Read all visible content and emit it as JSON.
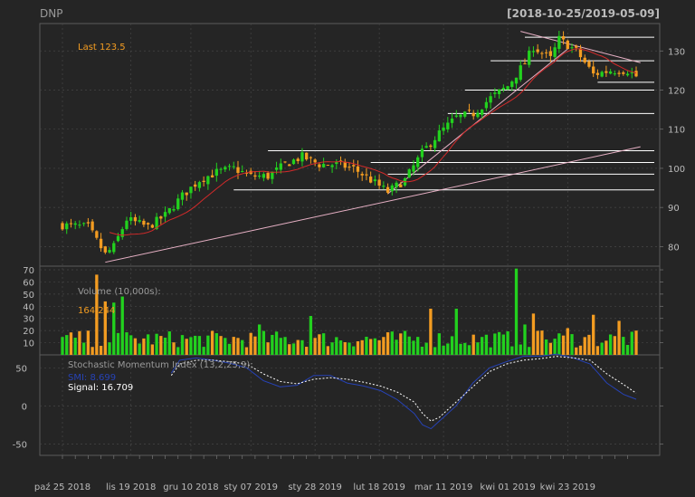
{
  "title": "DNP",
  "date_range": "[2018-10-25/2019-05-09]",
  "last_label": "Last 123.5",
  "volume_label": "Volume (10,000s):",
  "volume_value": "164,244",
  "smi_label": "Stochastic Momentum Index (13,2,25,9):",
  "smi_value": "SMI: 8.699",
  "signal_value": "Signal: 16.709",
  "colors": {
    "background": "#252525",
    "up": "#22d11e",
    "down": "#f39c21",
    "grid": "#464646",
    "sma": "#d42a2a",
    "trendline": "#e6b0c4",
    "smi": "#2642b5",
    "signal": "#ffffff",
    "last": "#f39c21",
    "text": "#bbbbbb"
  },
  "chart_data": [
    {
      "type": "candlestick",
      "title": "DNP",
      "ylim": [
        75,
        137
      ],
      "yticks": [
        80,
        90,
        100,
        110,
        120,
        130
      ],
      "x_tick_labels": [
        "paź 25 2018",
        "lis 19 2018",
        "gru 10 2018",
        "sty 07 2019",
        "sty 28 2019",
        "lut 18 2019",
        "mar 11 2019",
        "kwi 01 2019",
        "kwi 23 2019"
      ],
      "x_tick_index": [
        0,
        16,
        30,
        44,
        59,
        74,
        89,
        104,
        118
      ],
      "n": 135,
      "anchors": [
        [
          0,
          85.5
        ],
        [
          6,
          85
        ],
        [
          10,
          78
        ],
        [
          12,
          80
        ],
        [
          15,
          87
        ],
        [
          20,
          85
        ],
        [
          24,
          88
        ],
        [
          28,
          93
        ],
        [
          32,
          97
        ],
        [
          36,
          99
        ],
        [
          40,
          100
        ],
        [
          44,
          98
        ],
        [
          48,
          98
        ],
        [
          52,
          101
        ],
        [
          56,
          103
        ],
        [
          60,
          101
        ],
        [
          64,
          101
        ],
        [
          68,
          100
        ],
        [
          72,
          97
        ],
        [
          76,
          94
        ],
        [
          80,
          97
        ],
        [
          84,
          104
        ],
        [
          88,
          109
        ],
        [
          92,
          113
        ],
        [
          96,
          114
        ],
        [
          100,
          118
        ],
        [
          104,
          121
        ],
        [
          108,
          127
        ],
        [
          110,
          131
        ],
        [
          114,
          128
        ],
        [
          116,
          133
        ],
        [
          120,
          130
        ],
        [
          124,
          124
        ],
        [
          128,
          125
        ],
        [
          132,
          125
        ],
        [
          134,
          123.5
        ]
      ],
      "last": 123.5,
      "sma_note": "moving average line",
      "horizontal_levels": [
        {
          "y": 133.5,
          "from": 108
        },
        {
          "y": 127.5,
          "from": 100
        },
        {
          "y": 122,
          "from": 125
        },
        {
          "y": 120,
          "from": 94
        },
        {
          "y": 114,
          "from": 90
        },
        {
          "y": 104.5,
          "from": 48
        },
        {
          "y": 101.5,
          "from": 72
        },
        {
          "y": 98.5,
          "from": 76
        },
        {
          "y": 94.5,
          "from": 40
        }
      ],
      "trendlines": [
        [
          [
            10,
            76
          ],
          [
            135,
            105.5
          ]
        ],
        [
          [
            76,
            93.5
          ],
          [
            118,
            130.5
          ]
        ],
        [
          [
            107,
            135
          ],
          [
            135,
            127
          ]
        ]
      ]
    },
    {
      "type": "bar",
      "title": "Volume (10,000s):",
      "ylim": [
        0,
        73
      ],
      "yticks": [
        10,
        20,
        30,
        40,
        50,
        60,
        70
      ],
      "spikes": [
        [
          8,
          66
        ],
        [
          10,
          44
        ],
        [
          12,
          43
        ],
        [
          14,
          48
        ],
        [
          46,
          25
        ],
        [
          58,
          32
        ],
        [
          86,
          38
        ],
        [
          92,
          38
        ],
        [
          106,
          71
        ],
        [
          108,
          25
        ],
        [
          110,
          34
        ],
        [
          112,
          20
        ],
        [
          118,
          22
        ],
        [
          124,
          33
        ],
        [
          130,
          28
        ]
      ],
      "last": 164244
    },
    {
      "type": "line",
      "title": "Stochastic Momentum Index (13,2,25,9):",
      "ylim": [
        -65,
        67
      ],
      "yticks": [
        -50,
        0,
        50
      ],
      "series": [
        {
          "name": "SMI",
          "anchors": [
            [
              26,
              43
            ],
            [
              28,
              60
            ],
            [
              32,
              63
            ],
            [
              36,
              60
            ],
            [
              40,
              56
            ],
            [
              44,
              50
            ],
            [
              48,
              33
            ],
            [
              52,
              25
            ],
            [
              56,
              27
            ],
            [
              60,
              40
            ],
            [
              64,
              40
            ],
            [
              68,
              30
            ],
            [
              72,
              26
            ],
            [
              76,
              20
            ],
            [
              80,
              8
            ],
            [
              84,
              -10
            ],
            [
              86,
              -25
            ],
            [
              88,
              -30
            ],
            [
              90,
              -20
            ],
            [
              94,
              0
            ],
            [
              98,
              30
            ],
            [
              102,
              50
            ],
            [
              106,
              58
            ],
            [
              110,
              65
            ],
            [
              114,
              65
            ],
            [
              118,
              68
            ],
            [
              122,
              63
            ],
            [
              126,
              55
            ],
            [
              130,
              30
            ],
            [
              134,
              15
            ],
            [
              137,
              8.699
            ]
          ]
        },
        {
          "name": "Signal",
          "anchors": [
            [
              26,
              40
            ],
            [
              28,
              55
            ],
            [
              32,
              60
            ],
            [
              36,
              60
            ],
            [
              40,
              58
            ],
            [
              44,
              55
            ],
            [
              48,
              42
            ],
            [
              52,
              32
            ],
            [
              56,
              29
            ],
            [
              60,
              35
            ],
            [
              64,
              37
            ],
            [
              68,
              35
            ],
            [
              72,
              31
            ],
            [
              76,
              26
            ],
            [
              80,
              18
            ],
            [
              84,
              5
            ],
            [
              86,
              -10
            ],
            [
              88,
              -20
            ],
            [
              90,
              -15
            ],
            [
              94,
              5
            ],
            [
              98,
              25
            ],
            [
              102,
              45
            ],
            [
              106,
              55
            ],
            [
              110,
              60
            ],
            [
              114,
              62
            ],
            [
              118,
              65
            ],
            [
              122,
              63
            ],
            [
              126,
              60
            ],
            [
              130,
              42
            ],
            [
              134,
              28
            ],
            [
              137,
              16.709
            ]
          ]
        }
      ]
    }
  ]
}
